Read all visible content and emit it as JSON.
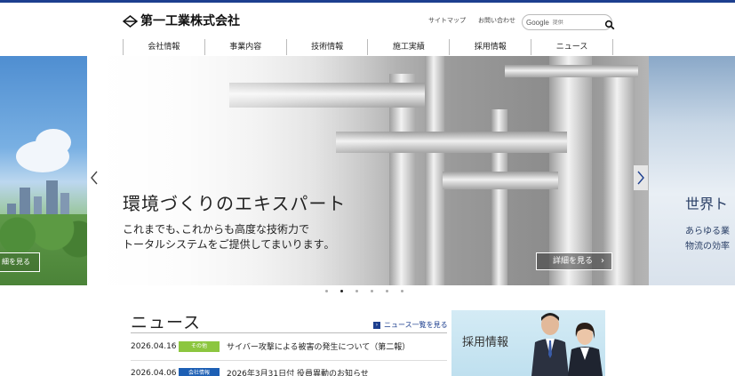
{
  "header": {
    "logo_text": "第一工業株式会社",
    "util_links": [
      "サイトマップ",
      "お問い合わせ"
    ],
    "search": {
      "brand": "Google",
      "placeholder": "提供"
    },
    "nav": [
      "会社情報",
      "事業内容",
      "技術情報",
      "施工実績",
      "採用情報",
      "ニュース"
    ]
  },
  "hero": {
    "left_slide": {
      "detail_label": "細を見る"
    },
    "main_slide": {
      "title": "環境づくりのエキスパート",
      "subtitle_line1": "これまでも､これからも高度な技術力で",
      "subtitle_line2": "トータルシステムをご提供してまいります｡",
      "detail_label": "詳細を見る"
    },
    "right_slide": {
      "title": "世界ト",
      "line1": "あらゆる業",
      "line2": "物流の効率"
    },
    "pager": {
      "count": 6,
      "active_index": 1
    }
  },
  "news": {
    "title": "ニュース",
    "all_link": "ニュース一覧を見る",
    "items": [
      {
        "date": "2026.04.16",
        "badge": "その他",
        "badge_color": "#8cc63f",
        "text": "サイバー攻撃による被害の発生について（第二報）"
      },
      {
        "date": "2026.04.06",
        "badge": "会社情報",
        "badge_color": "#1d5fb4",
        "text": "2026年3月31日付 役員異動のお知らせ"
      }
    ]
  },
  "recruit": {
    "label": "採用情報"
  },
  "colors": {
    "brand_navy": "#1d3f8f",
    "badge_other": "#8cc63f",
    "badge_company": "#1d5fb4"
  }
}
